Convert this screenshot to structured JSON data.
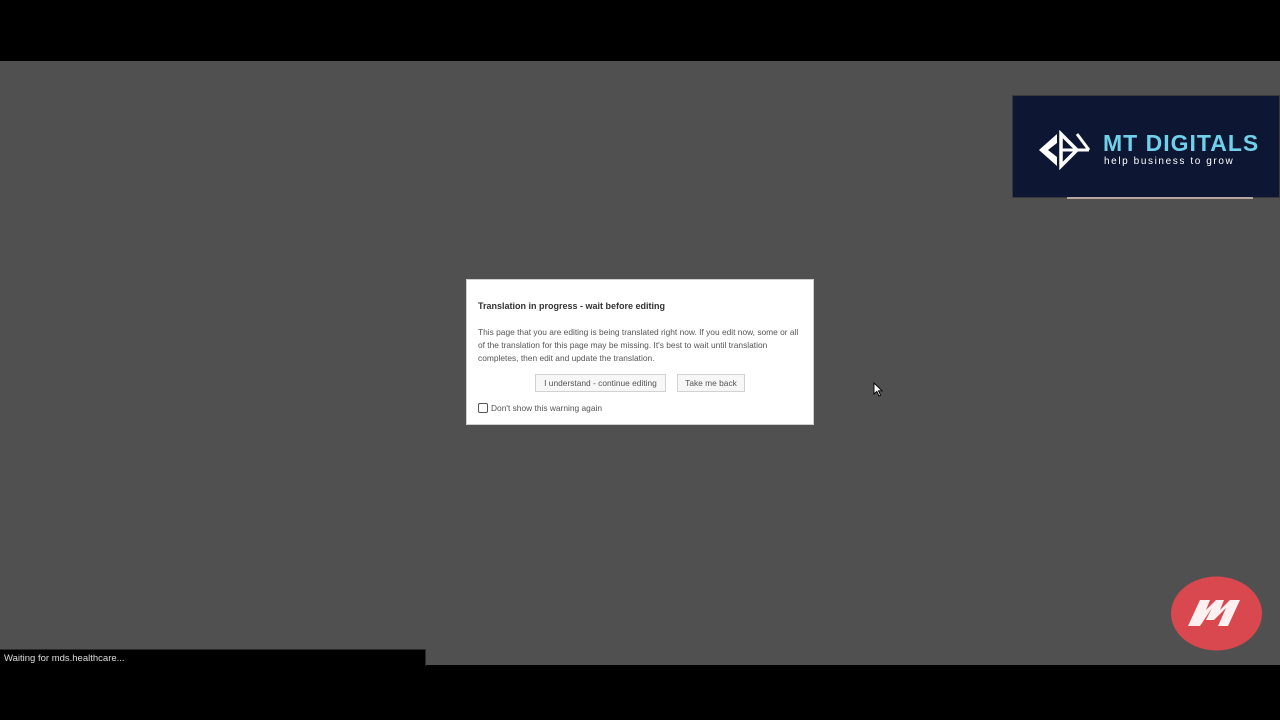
{
  "overlay": {
    "logo_title": "MT DIGITALS",
    "logo_tagline": "help business to grow",
    "logo_icon": "mt-digitals-logo-mark",
    "brand_icon": "red-circle-brand-logo"
  },
  "dialog": {
    "title": "Translation in progress - wait before editing",
    "body": "This page that you are editing is being translated right now. If you edit now, some or all of the translation for this page may be missing. It's best to wait until translation completes, then edit and update the translation.",
    "continue_button": "I understand - continue editing",
    "back_button": "Take me back",
    "checkbox_label": "Don't show this warning again",
    "checkbox_checked": false
  },
  "status_bar": {
    "text": "Waiting for mds.healthcare..."
  },
  "colors": {
    "backdrop": "#505050",
    "logo_background": "#0d1633",
    "logo_accent": "#6fd0ea",
    "brand_red": "#d9474f"
  }
}
